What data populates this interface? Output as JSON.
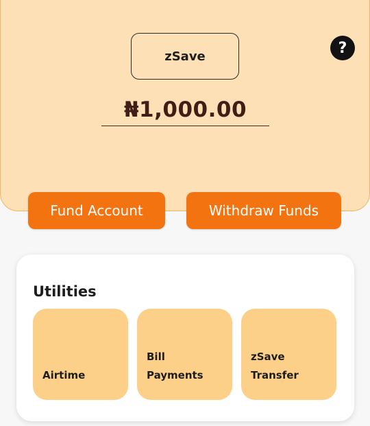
{
  "header": {
    "wallet_name": "zSave",
    "help_icon": "question-mark-icon",
    "balance": "₦1,000.00"
  },
  "actions": {
    "fund_label": "Fund Account",
    "withdraw_label": "Withdraw Funds"
  },
  "utilities": {
    "title": "Utilities",
    "items": [
      {
        "line1": "",
        "line2": "Airtime"
      },
      {
        "line1": "Bill",
        "line2": "Payments"
      },
      {
        "line1": "zSave",
        "line2": "Transfer"
      }
    ]
  },
  "colors": {
    "header_bg": "#fde0b5",
    "accent": "#f37311",
    "tile_bg": "#fdd089",
    "balance_text": "#421d15"
  }
}
